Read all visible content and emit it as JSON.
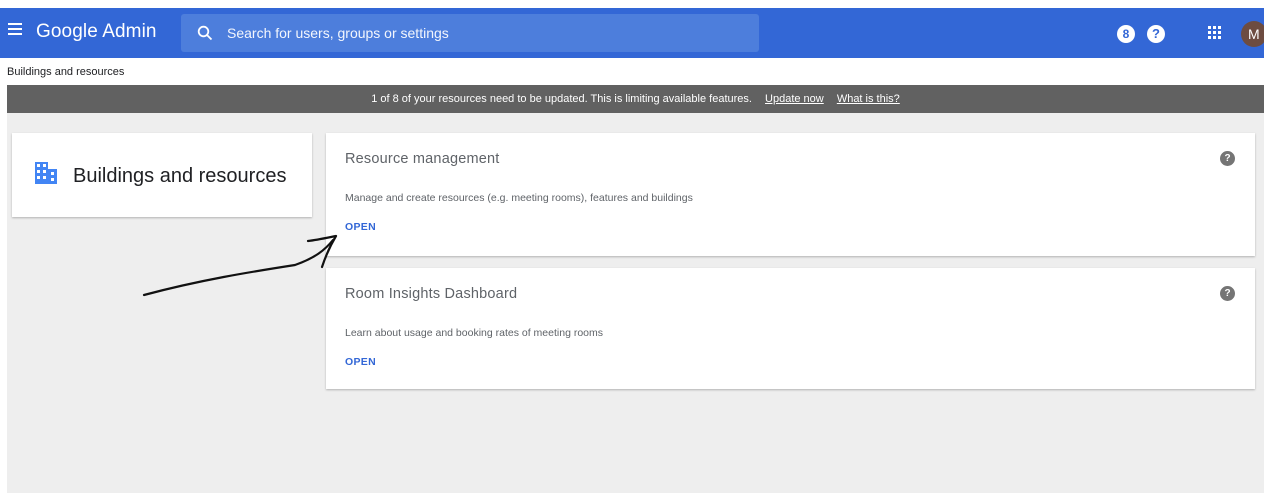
{
  "header": {
    "app_title": "Google Admin",
    "search_placeholder": "Search for users, groups or settings",
    "security_badge": "8",
    "help_glyph": "?",
    "avatar_initial": "M",
    "icons": [
      "menu-icon",
      "search-icon",
      "security-badge-icon",
      "help-icon",
      "apps-grid-icon"
    ]
  },
  "breadcrumb": "Buildings and resources",
  "banner": {
    "message": "1 of 8 of your resources need to be updated. This is limiting available features.",
    "update_link": "Update now",
    "info_link": "What is this?"
  },
  "side_card": {
    "title": "Buildings and resources",
    "icon": "building-icon",
    "icon_color": "#4285f4"
  },
  "cards": [
    {
      "title": "Resource management",
      "description": "Manage and create resources (e.g. meeting rooms), features and buildings",
      "action": "OPEN",
      "help_glyph": "?"
    },
    {
      "title": "Room Insights Dashboard",
      "description": "Learn about usage and booking rates of meeting rooms",
      "action": "OPEN",
      "help_glyph": "?"
    }
  ],
  "colors": {
    "header_bg": "#3367d6",
    "banner_bg": "#616161",
    "link_blue": "#3367d6",
    "page_bg": "#eeeeee"
  }
}
